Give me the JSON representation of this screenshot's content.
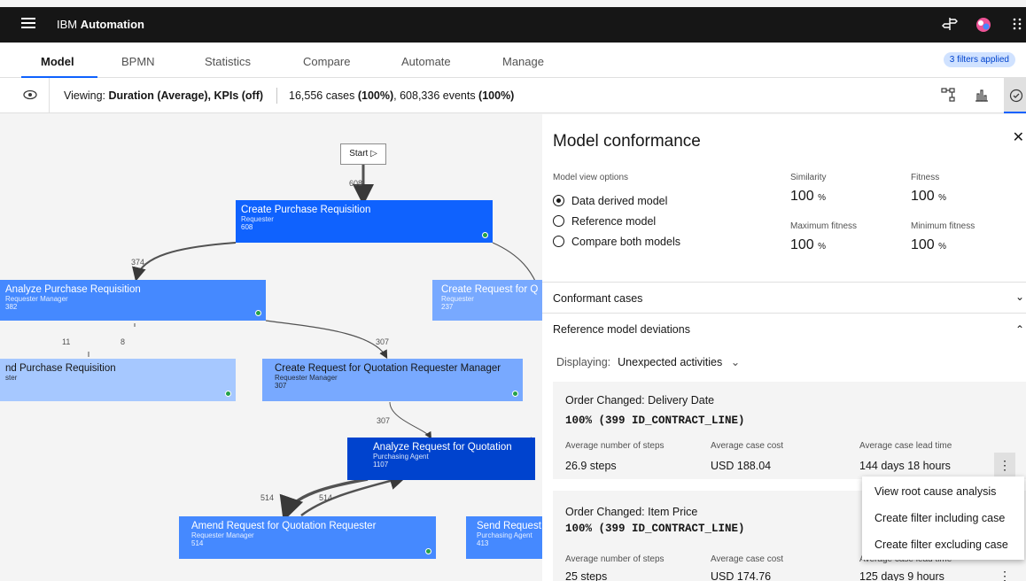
{
  "topbar": {
    "menu_icon": "hamburger-icon",
    "brand_prefix": "IBM ",
    "brand_name": "Automation"
  },
  "tabs": [
    {
      "label": "Model",
      "active": true
    },
    {
      "label": "BPMN"
    },
    {
      "label": "Statistics"
    },
    {
      "label": "Compare"
    },
    {
      "label": "Automate"
    },
    {
      "label": "Manage"
    }
  ],
  "filters_badge": "3 filters applied",
  "viewbar": {
    "viewing_label": "Viewing: ",
    "viewing_value": "Duration (Average), KPIs (off)",
    "cases_count": "16,556 cases ",
    "cases_pct": "(100%)",
    "events_count": ", 608,336 events ",
    "events_pct": "(100%)"
  },
  "graph": {
    "start_label": "Start ▷",
    "nodes": [
      {
        "title": "Create Purchase Requisition",
        "role": "Requester",
        "count": "608"
      },
      {
        "title": "Analyze Purchase Requisition",
        "role": "Requester Manager",
        "count": "382"
      },
      {
        "title": "Create Request for Q",
        "role": "Requester",
        "count": "237"
      },
      {
        "title": "nd Purchase Requisition",
        "role": "ster",
        "count": ""
      },
      {
        "title": "Create Request for Quotation Requester Manager",
        "role": "Requester Manager",
        "count": "307"
      },
      {
        "title": "Analyze Request for Quotation",
        "role": "Purchasing Agent",
        "count": "1107"
      },
      {
        "title": "Amend Request for Quotation Requester",
        "role": "Requester Manager",
        "count": "514"
      },
      {
        "title": "Send Request",
        "role": "Purchasing Agent",
        "count": "413"
      }
    ],
    "edge_labels": [
      "608",
      "374",
      "11",
      "8",
      "307",
      "307",
      "514",
      "514"
    ]
  },
  "panel": {
    "title": "Model conformance",
    "close_icon": "close-icon",
    "view_options_label": "Model view options",
    "options": [
      {
        "label": "Data derived model",
        "selected": true
      },
      {
        "label": "Reference model",
        "selected": false
      },
      {
        "label": "Compare both models",
        "selected": false
      }
    ],
    "metrics": [
      {
        "label": "Similarity",
        "value": "100",
        "unit": "%"
      },
      {
        "label": "Fitness",
        "value": "100",
        "unit": "%"
      },
      {
        "label": "Maximum fitness",
        "value": "100",
        "unit": "%"
      },
      {
        "label": "Minimum fitness",
        "value": "100",
        "unit": "%"
      }
    ],
    "conformant_cases": "Conformant cases",
    "deviations": "Reference model deviations",
    "displaying_label": "Displaying:",
    "displaying_value": "Unexpected activities",
    "cards": [
      {
        "title": "Order Changed: Delivery Date",
        "subtitle": "100% (399 ID_CONTRACT_LINE)",
        "labels": [
          "Average number of steps",
          "Average case cost",
          "Average case lead time"
        ],
        "values": [
          "26.9 steps",
          "USD 188.04",
          "144 days 18 hours"
        ]
      },
      {
        "title": "Order Changed: Item Price",
        "subtitle": "100% (399 ID_CONTRACT_LINE)",
        "labels": [
          "Average number of steps",
          "Average case cost",
          "Average case lead time"
        ],
        "values": [
          "25 steps",
          "USD 174.76",
          "125 days 9 hours"
        ]
      }
    ]
  },
  "menu": {
    "items": [
      "View root cause analysis",
      "Create filter including case",
      "Create filter excluding case"
    ]
  },
  "colors": {
    "node_blue": "#0f62fe",
    "node_dark": "#0043ce",
    "node_light": "#78a9ff",
    "node_mid": "#4589ff"
  }
}
